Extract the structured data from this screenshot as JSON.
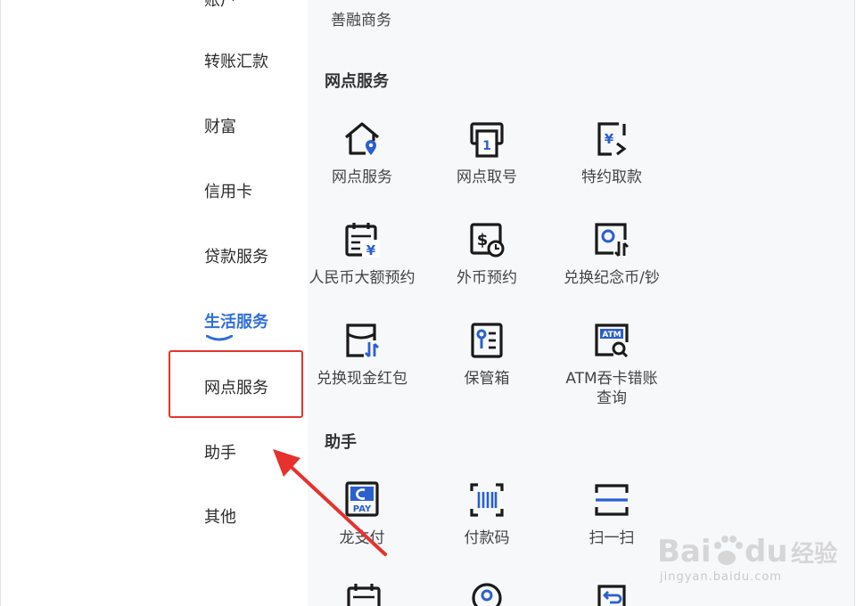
{
  "sidebar": {
    "items": [
      {
        "label": "账户"
      },
      {
        "label": "转账汇款"
      },
      {
        "label": "财富"
      },
      {
        "label": "信用卡"
      },
      {
        "label": "贷款服务"
      },
      {
        "label": "生活服务"
      },
      {
        "label": "网点服务"
      },
      {
        "label": "助手"
      },
      {
        "label": "其他"
      }
    ],
    "active_item": "生活服务",
    "highlighted_item": "网点服务"
  },
  "content": {
    "prev_section_item": "善融商务",
    "sections": [
      {
        "title": "网点服务",
        "items": [
          {
            "label": "网点服务",
            "icon": "branch-location-icon"
          },
          {
            "label": "网点取号",
            "icon": "queue-ticket-icon"
          },
          {
            "label": "特约取款",
            "icon": "appointment-withdrawal-icon"
          },
          {
            "label": "人民币大额预约",
            "icon": "rmb-large-reservation-icon"
          },
          {
            "label": "外币预约",
            "icon": "foreign-currency-reservation-icon"
          },
          {
            "label": "兑换纪念币/钞",
            "icon": "commemorative-coin-exchange-icon"
          },
          {
            "label": "兑换现金红包",
            "icon": "cash-red-packet-icon"
          },
          {
            "label": "保管箱",
            "icon": "safe-deposit-box-icon"
          },
          {
            "label": "ATM吞卡错账\n查询",
            "icon": "atm-query-icon"
          }
        ]
      },
      {
        "title": "助手",
        "items": [
          {
            "label": "龙支付",
            "icon": "long-pay-icon"
          },
          {
            "label": "付款码",
            "icon": "payment-code-icon"
          },
          {
            "label": "扫一扫",
            "icon": "scan-icon"
          }
        ]
      }
    ]
  },
  "watermark": {
    "logo_text": "Bai 经验",
    "url": "jingyan.baidu.com"
  },
  "colors": {
    "active": "#2f6fd6",
    "highlight": "#e5322d",
    "icon_dark": "#1a1a1a",
    "icon_accent": "#2b5fd0"
  }
}
